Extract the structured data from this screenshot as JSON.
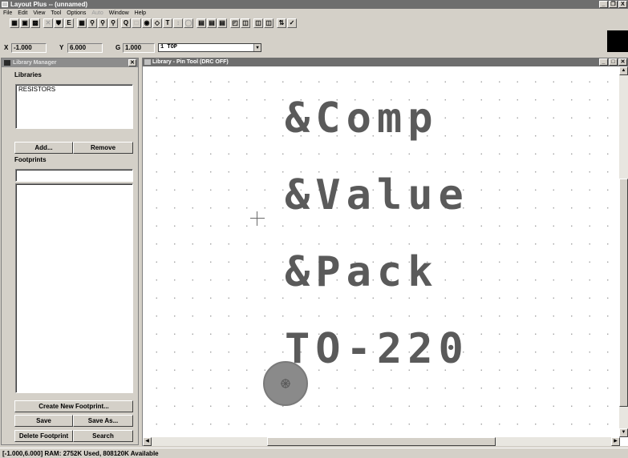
{
  "app": {
    "title": "Layout Plus -- (unnamed)",
    "window_buttons": [
      "_",
      "Й",
      "X"
    ]
  },
  "menu": {
    "items": [
      {
        "label": "File",
        "enabled": true
      },
      {
        "label": "Edit",
        "enabled": true
      },
      {
        "label": "View",
        "enabled": true
      },
      {
        "label": "Tool",
        "enabled": true
      },
      {
        "label": "Options",
        "enabled": true
      },
      {
        "label": "Auto",
        "enabled": false
      },
      {
        "label": "Window",
        "enabled": true
      },
      {
        "label": "Help",
        "enabled": true
      }
    ]
  },
  "toolbar": {
    "layer": "1 TOP"
  },
  "coords": {
    "x_label": "X",
    "x_value": "-1.000",
    "y_label": "Y",
    "y_value": "6.000",
    "g_label": "G",
    "g_value": "1.000"
  },
  "library_manager": {
    "title": "Library Manager",
    "libraries_heading": "Libraries",
    "libraries": [
      "RESISTORS"
    ],
    "add_label": "Add...",
    "remove_label": "Remove",
    "footprints_heading": "Footprints",
    "footprint_filter": "",
    "create_label": "Create New Footprint...",
    "save_label": "Save",
    "save_as_label": "Save As...",
    "delete_label": "Delete Footprint",
    "search_label": "Search"
  },
  "canvas": {
    "title": "Library - Pin Tool (DRC OFF)",
    "labels": [
      "&Comp",
      "&Value",
      "&Pack",
      "TO-220"
    ]
  },
  "status": {
    "text": "[-1.000,6.000]  RAM: 2752K Used, 808120K Available"
  }
}
